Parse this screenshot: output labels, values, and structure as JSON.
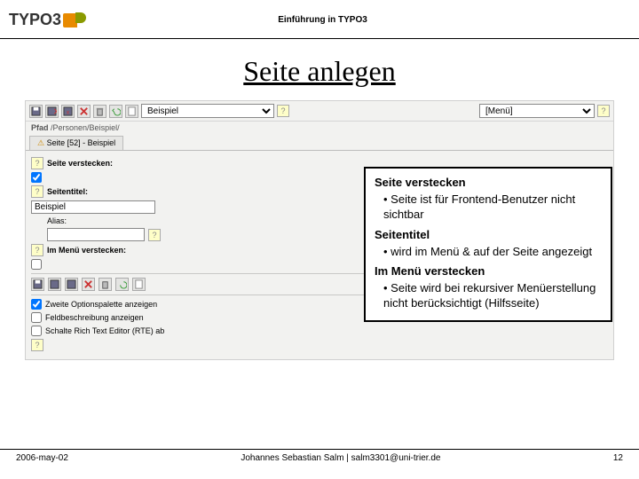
{
  "header": {
    "logo_text": "TYPO3",
    "title": "Einführung in TYPO3"
  },
  "slide": {
    "title": "Seite anlegen"
  },
  "toolbar": {
    "type_select": "Beispiel",
    "menu_select": "[Menü]"
  },
  "path": {
    "label": "Pfad",
    "value": "/Personen/Beispiel/"
  },
  "tab": {
    "label": "Seite [52] - Beispiel"
  },
  "form": {
    "hide": {
      "label": "Seite verstecken:"
    },
    "pagetitle": {
      "label": "Seitentitel:",
      "value": "Beispiel"
    },
    "alias": {
      "label": "Alias:",
      "value": ""
    },
    "hidemenu": {
      "label": "Im Menü verstecken:"
    }
  },
  "options": {
    "opt1": "Zweite Optionspalette anzeigen",
    "opt2": "Feldbeschreibung anzeigen",
    "opt3": "Schalte Rich Text Editor (RTE) ab"
  },
  "callout": {
    "h1": "Seite verstecken",
    "p1": "• Seite ist für Frontend-Benutzer nicht sichtbar",
    "h2": "Seitentitel",
    "p2": "• wird im Menü & auf der Seite angezeigt",
    "h3": "Im Menü verstecken",
    "p3": "• Seite wird bei rekursiver Menüerstellung nicht berücksichtigt (Hilfsseite)"
  },
  "footer": {
    "date": "2006-may-02",
    "author": "Johannes Sebastian Salm | salm3301@uni-trier.de",
    "pageno": "12"
  }
}
